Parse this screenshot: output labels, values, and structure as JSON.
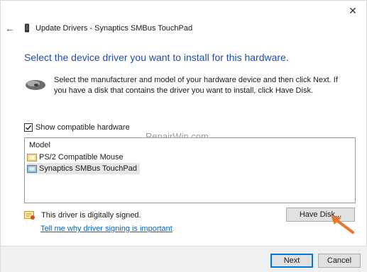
{
  "window": {
    "title": "Update Drivers - Synaptics SMBus TouchPad",
    "close_glyph": "✕",
    "back_glyph": "←"
  },
  "heading": "Select the device driver you want to install for this hardware.",
  "description": "Select the manufacturer and model of your hardware device and then click Next. If you have a disk that contains the driver you want to install, click Have Disk.",
  "compatible": {
    "label": "Show compatible hardware",
    "checked": true
  },
  "model_list": {
    "header": "Model",
    "items": [
      {
        "label": "PS/2 Compatible Mouse",
        "selected": false
      },
      {
        "label": "Synaptics SMBus TouchPad",
        "selected": true
      }
    ]
  },
  "watermark": "RepairWin.com",
  "signed": {
    "text": "This driver is digitally signed.",
    "link": "Tell me why driver signing is important"
  },
  "buttons": {
    "have_disk": "Have Disk...",
    "next": "Next",
    "cancel": "Cancel"
  },
  "colors": {
    "heading": "#1f4ea8",
    "link": "#0b63c4",
    "arrow": "#e8772e",
    "primary_border": "#0078d7"
  },
  "icons": {
    "device": "device-icon",
    "mouse": "mouse-icon",
    "driver_item": "driver-item-icon",
    "signed_cert": "certificate-icon",
    "arrow": "arrow-annotation-icon"
  }
}
